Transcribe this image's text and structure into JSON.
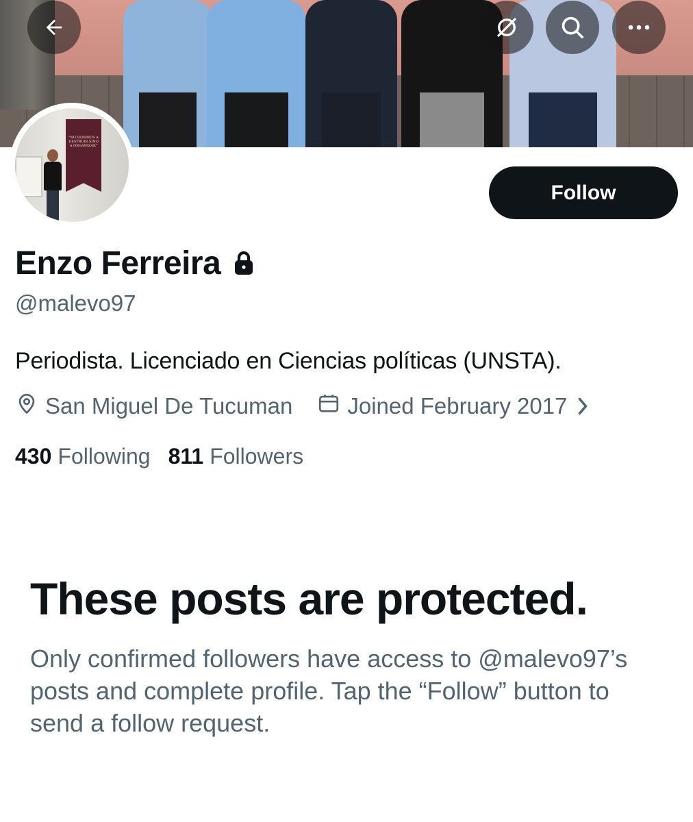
{
  "header": {
    "back_icon": "arrow-left-icon",
    "actions": [
      "no-signal-icon",
      "search-icon",
      "more-icon"
    ]
  },
  "avatar": {
    "flag_text": "\"NO VENIMOS A DESTRUIR SINO A ORGANIZAR\""
  },
  "follow_button": {
    "label": "Follow"
  },
  "profile": {
    "name": "Enzo Ferreira",
    "protected_icon": "lock-icon",
    "handle": "@malevo97",
    "bio": "Periodista. Licenciado en Ciencias políticas (UNSTA).",
    "location": "San Miguel De Tucuman",
    "joined": "Joined February 2017",
    "following_count": "430",
    "following_label": "Following",
    "followers_count": "811",
    "followers_label": "Followers"
  },
  "protected": {
    "title": "These posts are protected.",
    "body": "Only confirmed followers have access to @malevo97’s posts and complete profile. Tap the “Follow” button to send a follow request."
  },
  "colors": {
    "text_primary": "#0f1419",
    "text_secondary": "#536471",
    "button_bg": "#0f1419",
    "button_text": "#ffffff"
  }
}
